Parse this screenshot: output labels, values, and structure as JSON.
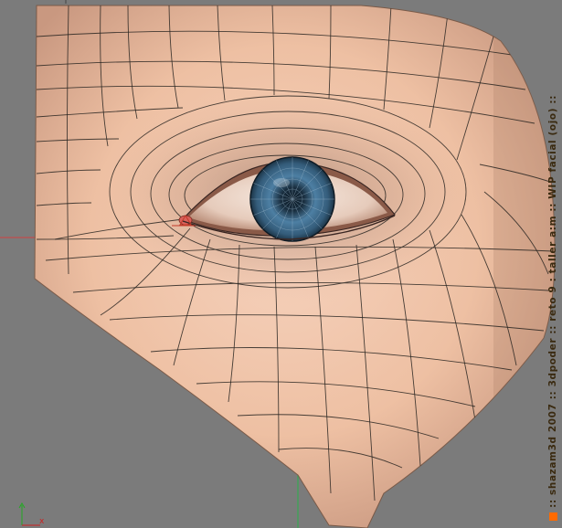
{
  "viewport": {
    "caption": ":: shazam3d 2007 :: 3dpoder :: reto 9 : taller a:m :: WIP facial (ojo) ::",
    "accent_color": "#ff6a00",
    "background_color": "#7b7b7b",
    "skin_color": "#eec2a6",
    "wire_color": "#2a2622",
    "iris_color": "#3d6a8a"
  },
  "gizmo": {
    "x_axis_color": "#cc2222",
    "y_axis_color": "#22aa22",
    "x_label": "x"
  },
  "icons": {
    "corner": "axis-gizmo-icon"
  }
}
